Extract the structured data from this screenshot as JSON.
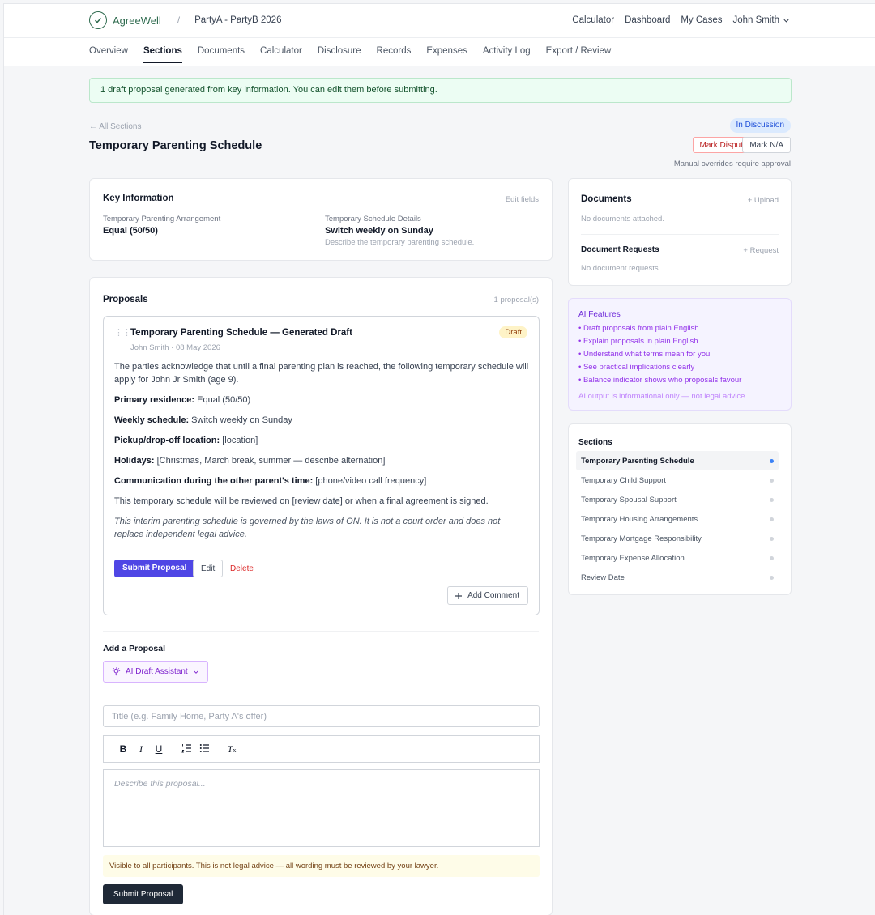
{
  "header": {
    "brand": "AgreeWell",
    "separator": "/",
    "case_name": "PartyA - PartyB 2026",
    "nav": [
      "Calculator",
      "Dashboard",
      "My Cases"
    ],
    "user": "John Smith"
  },
  "tabs": [
    "Overview",
    "Sections",
    "Documents",
    "Calculator",
    "Disclosure",
    "Records",
    "Expenses",
    "Activity Log",
    "Export / Review"
  ],
  "active_tab": "Sections",
  "notice": "1 draft proposal generated from key information. You can edit them before submitting.",
  "page": {
    "back_link": "← All Sections",
    "title": "Temporary Parenting Schedule",
    "status": "In Discussion",
    "mark_disputed": "Mark Disputed",
    "mark_na": "Mark N/A",
    "override_note": "Manual overrides require approval"
  },
  "key_info": {
    "title": "Key Information",
    "edit_link": "Edit fields",
    "fields": [
      {
        "label": "Temporary Parenting Arrangement",
        "value": "Equal (50/50)",
        "hint": ""
      },
      {
        "label": "Temporary Schedule Details",
        "value": "Switch weekly on Sunday",
        "hint": "Describe the temporary parenting schedule."
      }
    ]
  },
  "proposals": {
    "title": "Proposals",
    "count": "1 proposal(s)",
    "item": {
      "title": "Temporary Parenting Schedule — Generated Draft",
      "badge": "Draft",
      "meta": "John Smith · 08 May 2026",
      "intro": "The parties acknowledge that until a final parenting plan is reached, the following temporary schedule will apply for John Jr Smith (age 9).",
      "lines": [
        {
          "label": "Primary residence:",
          "text": " Equal (50/50)"
        },
        {
          "label": "Weekly schedule:",
          "text": " Switch weekly on Sunday"
        },
        {
          "label": "Pickup/drop-off location:",
          "text": " [location]"
        },
        {
          "label": "Holidays:",
          "text": " [Christmas, March break, summer — describe alternation]"
        },
        {
          "label": "Communication during the other parent's time:",
          "text": " [phone/video call frequency]"
        }
      ],
      "review": "This temporary schedule will be reviewed on [review date] or when a final agreement is signed.",
      "governing": "This interim parenting schedule is governed by the laws of ON. It is not a court order and does not replace independent legal advice.",
      "submit": "Submit Proposal",
      "edit": "Edit",
      "delete": "Delete",
      "add_comment": "Add Comment"
    },
    "add": {
      "title": "Add a Proposal",
      "ai_assistant": "AI Draft Assistant",
      "title_placeholder": "Title (e.g. Family Home, Party A's offer)",
      "body_placeholder": "Describe this proposal...",
      "legal_note": "Visible to all participants. This is not legal advice — all wording must be reviewed by your lawyer.",
      "submit": "Submit Proposal"
    }
  },
  "documents": {
    "title": "Documents",
    "upload": "+ Upload",
    "empty": "No documents attached.",
    "requests_title": "Document Requests",
    "request": "+ Request",
    "requests_empty": "No document requests."
  },
  "ai_features": {
    "title": "AI Features",
    "items": [
      "• Draft proposals from plain English",
      "• Explain proposals in plain English",
      "• Understand what terms mean for you",
      "• See practical implications clearly",
      "• Balance indicator shows who proposals favour"
    ],
    "disclaimer": "AI output is informational only — not legal advice."
  },
  "sections": {
    "title": "Sections",
    "items": [
      "Temporary Parenting Schedule",
      "Temporary Child Support",
      "Temporary Spousal Support",
      "Temporary Housing Arrangements",
      "Temporary Mortgage Responsibility",
      "Temporary Expense Allocation",
      "Review Date"
    ],
    "active": "Temporary Parenting Schedule"
  }
}
